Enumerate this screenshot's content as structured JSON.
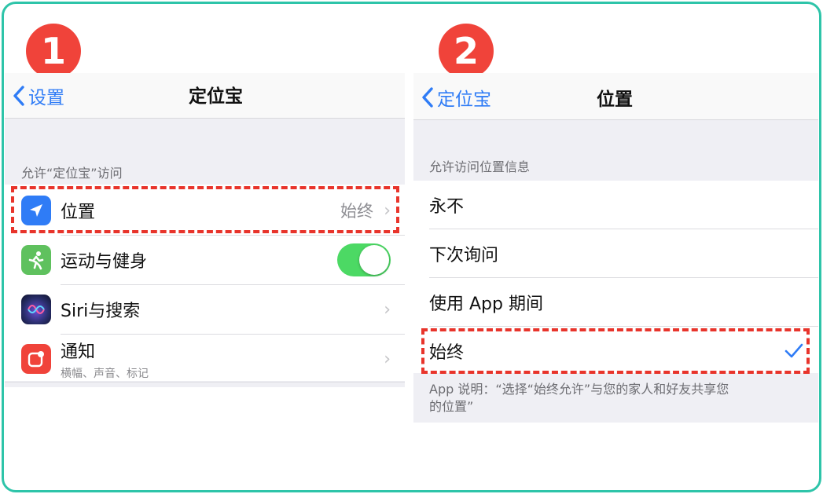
{
  "steps": [
    "1",
    "2"
  ],
  "panel1": {
    "back_label": "设置",
    "title": "定位宝",
    "section_header": "允许“定位宝”访问",
    "rows": [
      {
        "label": "位置",
        "value": "始终",
        "icon": "location-arrow-icon"
      },
      {
        "label": "运动与健身",
        "toggle_on": true,
        "icon": "fitness-runner-icon"
      },
      {
        "label": "Siri与搜索",
        "icon": "siri-icon"
      },
      {
        "label": "通知",
        "sublabel": "横幅、声音、标记",
        "icon": "notification-icon"
      }
    ]
  },
  "panel2": {
    "back_label": "定位宝",
    "title": "位置",
    "section_header": "允许访问位置信息",
    "options": [
      "永不",
      "下次询问",
      "使用 App 期间",
      "始终"
    ],
    "selected_option": "始终",
    "footer_line1": "App 说明：“选择“始终允许”与您的家人和好友共享您",
    "footer_line2": "的位置”"
  },
  "colors": {
    "accent": "#2f7cf6",
    "badge": "#f0433a",
    "frame": "#2ec4a9",
    "highlight": "#e8342b",
    "toggle_on": "#4cd964"
  }
}
